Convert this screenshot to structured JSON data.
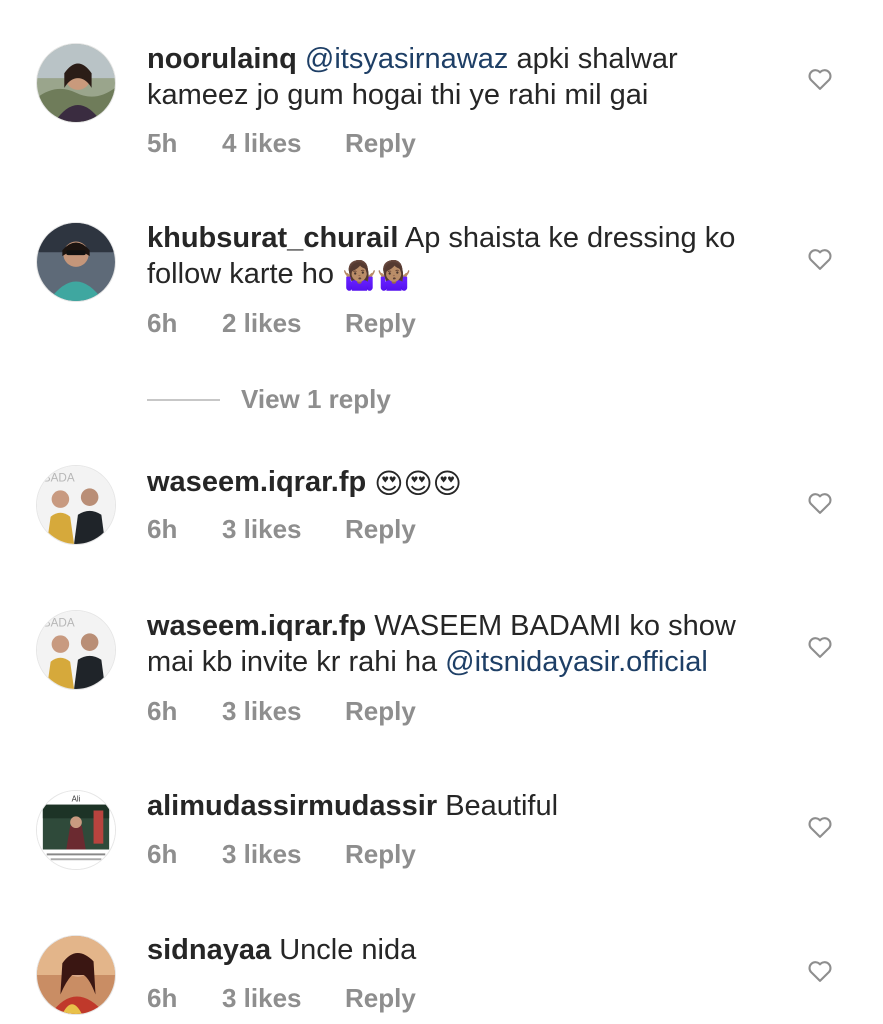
{
  "comments": [
    {
      "username": "noorulainq",
      "mention_before": "@itsyasirnawaz",
      "text": " apki shalwar kameez jo gum hogai thi ye rahi mil gai",
      "time": "5h",
      "likes": "4 likes",
      "reply": "Reply",
      "avatar": "avatar-woman-outdoor"
    },
    {
      "username": "khubsurat_churail",
      "text": " Ap shaista ke dressing ko follow karte ho ",
      "emoji": "🤷🏽‍♀️🤷🏽‍♀️",
      "time": "6h",
      "likes": "2 likes",
      "reply": "Reply",
      "avatar": "avatar-woman-sunglasses"
    },
    {
      "username": "waseem.iqrar.fp",
      "text": " ",
      "emoji": "😍😍😍",
      "time": "6h",
      "likes": "3 likes",
      "reply": "Reply",
      "avatar": "avatar-two-men"
    },
    {
      "username": "waseem.iqrar.fp",
      "text": " WASEEM BADAMI ko show mai kb invite kr rahi ha ",
      "mention_after": "@itsnidayasir.official",
      "time": "6h",
      "likes": "3 likes",
      "reply": "Reply",
      "avatar": "avatar-two-men"
    },
    {
      "username": "alimudassirmudassir",
      "text": " Beautiful",
      "time": "6h",
      "likes": "3 likes",
      "reply": "Reply",
      "avatar": "avatar-poster-ali",
      "avatar_label": "Ali"
    },
    {
      "username": "sidnayaa",
      "text": " Uncle nida",
      "time": "6h",
      "likes": "3 likes",
      "reply": "Reply",
      "avatar": "avatar-woman-red"
    }
  ],
  "view_replies": "View 1 reply",
  "colors": {
    "text": "#262626",
    "meta": "#8e8e8e",
    "mention": "#1e3f66",
    "divider": "#c7c7c7"
  },
  "icons": {
    "like": "heart-outline-icon"
  }
}
